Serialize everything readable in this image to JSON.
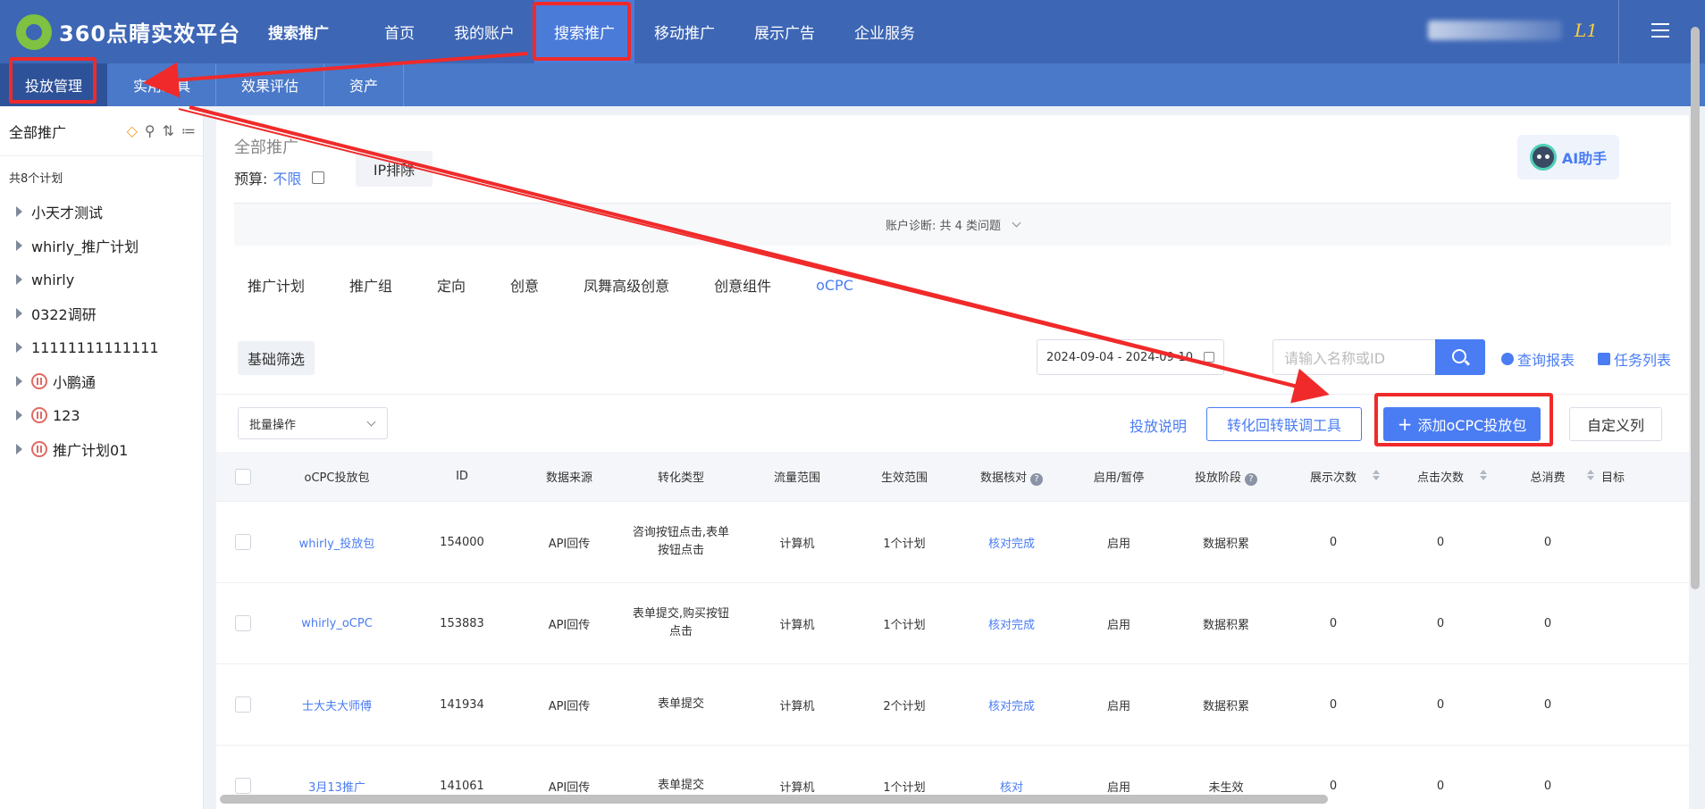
{
  "header": {
    "logo_text": "360点睛实效平台",
    "product": "搜索推广",
    "nav": [
      "首页",
      "我的账户",
      "搜索推广",
      "移动推广",
      "展示广告",
      "企业服务"
    ],
    "active_nav": "搜索推广",
    "level": "L1"
  },
  "subnav": {
    "items": [
      "投放管理",
      "实用工具",
      "效果评估",
      "资产"
    ],
    "active": "投放管理"
  },
  "sidebar": {
    "title": "全部推广",
    "count": "共8个计划",
    "plans": [
      {
        "name": "小天才测试",
        "paused": false
      },
      {
        "name": "whirly_推广计划",
        "paused": false
      },
      {
        "name": "whirly",
        "paused": false
      },
      {
        "name": "0322调研",
        "paused": false
      },
      {
        "name": "11111111111111",
        "paused": false
      },
      {
        "name": "小鹏通",
        "paused": true
      },
      {
        "name": "123",
        "paused": true
      },
      {
        "name": "推广计划01",
        "paused": true
      }
    ]
  },
  "summary": {
    "title": "全部推广",
    "budget_label": "预算:",
    "budget_value": "不限",
    "ip_button": "IP排除",
    "ai_button": "AI助手",
    "diagnosis": "账户诊断: 共 4 类问题"
  },
  "tabs": {
    "items": [
      "推广计划",
      "推广组",
      "定向",
      "创意",
      "凤舞高级创意",
      "创意组件",
      "oCPC"
    ],
    "active": "oCPC"
  },
  "filters": {
    "basic": "基础筛选",
    "date_range": "2024-09-04 - 2024-09-10",
    "search_placeholder": "请输入名称或ID",
    "query_report": "查询报表",
    "task_list": "任务列表"
  },
  "actions": {
    "batch": "批量操作",
    "explain": "投放说明",
    "tool": "转化回转联调工具",
    "add": "添加oCPC投放包",
    "custom": "自定义列"
  },
  "table": {
    "headers": [
      "oCPC投放包",
      "ID",
      "数据来源",
      "转化类型",
      "流量范围",
      "生效范围",
      "数据核对",
      "启用/暂停",
      "投放阶段",
      "展示次数",
      "点击次数",
      "总消费",
      "目标"
    ],
    "rows": [
      {
        "name": "whirly_投放包",
        "id": "154000",
        "source": "API回传",
        "conv": "咨询按钮点击,表单按钮点击",
        "traffic": "计算机",
        "scope": "1个计划",
        "check": "核对完成",
        "status": "启用",
        "stage": "数据积累",
        "impr": "0",
        "clicks": "0",
        "cost": "0"
      },
      {
        "name": "whirly_oCPC",
        "id": "153883",
        "source": "API回传",
        "conv": "表单提交,购买按钮点击",
        "traffic": "计算机",
        "scope": "1个计划",
        "check": "核对完成",
        "status": "启用",
        "stage": "数据积累",
        "impr": "0",
        "clicks": "0",
        "cost": "0"
      },
      {
        "name": "士大夫大师傅",
        "id": "141934",
        "source": "API回传",
        "conv": "表单提交",
        "traffic": "计算机",
        "scope": "2个计划",
        "check": "核对完成",
        "status": "启用",
        "stage": "数据积累",
        "impr": "0",
        "clicks": "0",
        "cost": "0"
      },
      {
        "name": "3月13推广",
        "id": "141061",
        "source": "API回传",
        "conv": "表单提交",
        "traffic": "计算机",
        "scope": "1个计划",
        "check": "核对",
        "status": "启用",
        "stage": "未生效",
        "impr": "0",
        "clicks": "0",
        "cost": "0"
      }
    ]
  },
  "colors": {
    "header": "#3d66b5",
    "accent": "#4a7cf3",
    "annotation": "#f02a2a"
  }
}
